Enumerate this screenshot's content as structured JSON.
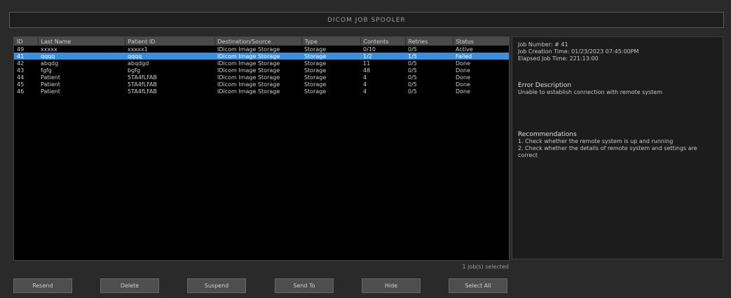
{
  "title": "DICOM JOB SPOOLER",
  "table": {
    "headers": [
      "ID",
      "Last Name",
      "Patient ID",
      "Destination/Source",
      "Type",
      "Contents",
      "Retries",
      "Status"
    ],
    "rows": [
      [
        "49",
        "xxxxx",
        "xxxxx1",
        "IDicom Image Storage",
        "Storage",
        "0/10",
        "0/5",
        "Active"
      ],
      [
        "41",
        "qqqq",
        "qqqq",
        "IDicom Image Storage",
        "Storage",
        "1/2",
        "1/5",
        "Failed"
      ],
      [
        "42",
        "abqdg",
        "abqdgd",
        "IDicom Image Storage",
        "Storage",
        "11",
        "0/5",
        "Done"
      ],
      [
        "43",
        "fgfg",
        "bgfg",
        "IDicom Image Storage",
        "Storage",
        "48",
        "0/5",
        "Done"
      ],
      [
        "44",
        "Patient",
        "5TA4fLFAB",
        "IDicom Image Storage",
        "Storage",
        "4",
        "0/5",
        "Done"
      ],
      [
        "45",
        "Patient",
        "5TA4fLFAB",
        "IDicom Image Storage",
        "Storage",
        "4",
        "0/5",
        "Done"
      ],
      [
        "46",
        "Patient",
        "5TA4fLFAB",
        "IDicom Image Storage",
        "Storage",
        "4",
        "0/5",
        "Done"
      ]
    ],
    "selected_index": 1
  },
  "details": {
    "job_number": "Job Number: # 41",
    "creation_time": "Job Creation Time: 01/23/2023 07:45:00PM",
    "elapsed": "Elapsed Job Time: 221:13:00",
    "error_heading": "Error Description",
    "error_text": "Unable to establish connection with remote system",
    "rec_heading": "Recommendations",
    "rec_1": "1. Check whether the remote system is up and running",
    "rec_2": "2. Check whether the details of remote system and settings are",
    "rec_2b": "correct"
  },
  "selection_count": "1 job(s) selected",
  "buttons": {
    "resend": "Resend",
    "delete": "Delete",
    "suspend": "Suspend",
    "send_to": "Send To",
    "hide": "Hide",
    "select_all": "Select All"
  }
}
